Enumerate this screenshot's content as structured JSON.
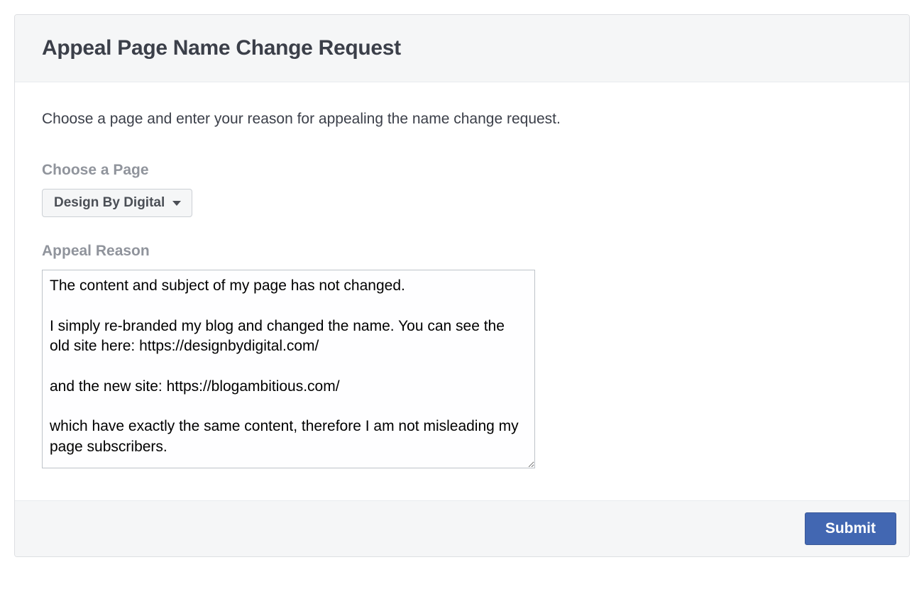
{
  "header": {
    "title": "Appeal Page Name Change Request"
  },
  "body": {
    "intro": "Choose a page and enter your reason for appealing the name change request.",
    "choose_page_label": "Choose a Page",
    "page_select_value": "Design By Digital",
    "appeal_reason_label": "Appeal Reason",
    "appeal_reason_value": "The content and subject of my page has not changed.\n\nI simply re-branded my blog and changed the name. You can see the old site here: https://designbydigital.com/\n\nand the new site: https://blogambitious.com/\n\nwhich have exactly the same content, therefore I am not misleading my page subscribers."
  },
  "footer": {
    "submit_label": "Submit"
  }
}
